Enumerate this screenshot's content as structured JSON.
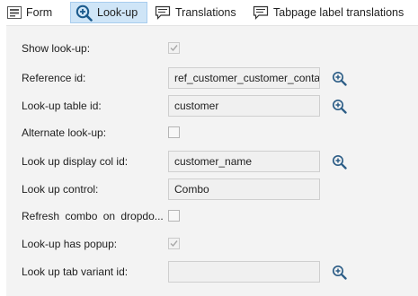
{
  "tabs": {
    "form": "Form",
    "lookup": "Look-up",
    "translations": "Translations",
    "tabpage": "Tabpage label translations"
  },
  "fields": {
    "show_lookup": {
      "label": "Show look-up:",
      "checked": true
    },
    "reference_id": {
      "label": "Reference id:",
      "value": "ref_customer_customer_conta"
    },
    "lookup_table_id": {
      "label": "Look-up table id:",
      "value": "customer"
    },
    "alternate_lookup": {
      "label": "Alternate look-up:",
      "checked": false
    },
    "lookup_display_col_id": {
      "label": "Look up display col id:",
      "value": "customer_name"
    },
    "lookup_control": {
      "label": "Look up control:",
      "value": "Combo"
    },
    "refresh_combo": {
      "label": "Refresh combo on dropdo...",
      "checked": false
    },
    "lookup_has_popup": {
      "label": "Look-up has popup:",
      "checked": true
    },
    "lookup_tab_variant_id": {
      "label": "Look up tab variant id:",
      "value": ""
    }
  },
  "icons": {
    "form": "form-icon",
    "lookup": "magnifier-plus-icon",
    "translations": "speech-bubble-icon",
    "tabpage": "speech-bubble-icon",
    "zoom": "magnifier-plus-icon"
  },
  "colors": {
    "active_tab": "#cfe5f7",
    "icon_blue": "#1b5a8c",
    "panel": "#f3f3f3"
  }
}
